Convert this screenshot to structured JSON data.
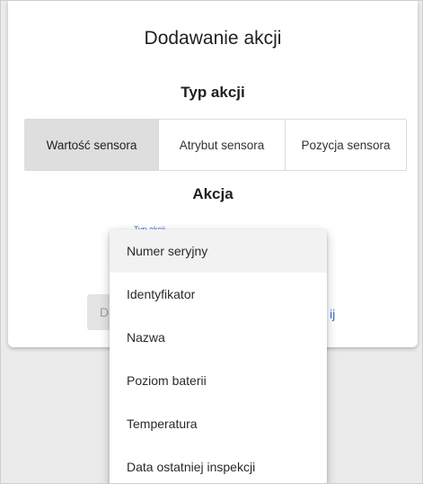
{
  "dialog": {
    "title": "Dodawanie akcji",
    "type_section_title": "Typ akcji",
    "action_section_title": "Akcja"
  },
  "action_types": [
    {
      "label": "Wartość sensora",
      "selected": true
    },
    {
      "label": "Atrybut sensora",
      "selected": false
    },
    {
      "label": "Pozycja sensora",
      "selected": false
    }
  ],
  "field": {
    "label": "Typ akcji"
  },
  "footer": {
    "left_button_label": "D",
    "right_button_label": "ij"
  },
  "dropdown": {
    "items": [
      {
        "label": "Numer seryjny",
        "active": true
      },
      {
        "label": "Identyfikator",
        "active": false
      },
      {
        "label": "Nazwa",
        "active": false
      },
      {
        "label": "Poziom baterii",
        "active": false
      },
      {
        "label": "Temperatura",
        "active": false
      },
      {
        "label": "Data ostatniej inspekcji",
        "active": false
      }
    ]
  },
  "colors": {
    "accent": "#3b6fd3",
    "backdrop": "#ebebeb",
    "selected_toggle": "#dedede"
  }
}
